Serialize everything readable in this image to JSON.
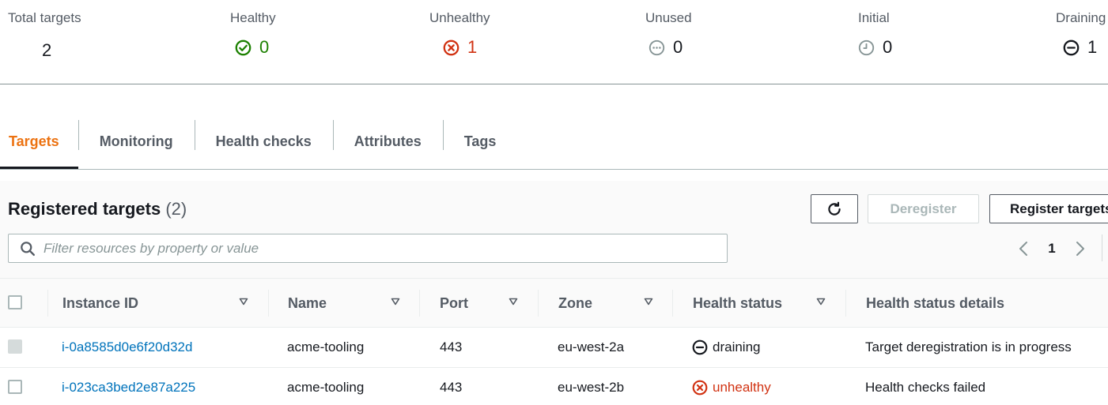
{
  "summary": {
    "total_targets": {
      "label": "Total targets",
      "value": "2"
    },
    "healthy": {
      "label": "Healthy",
      "value": "0",
      "icon": "check-circle-icon",
      "color": "#1d8102"
    },
    "unhealthy": {
      "label": "Unhealthy",
      "value": "1",
      "icon": "x-circle-icon",
      "color": "#d13212"
    },
    "unused": {
      "label": "Unused",
      "value": "0",
      "icon": "ellipsis-circle-icon",
      "color": "#879596"
    },
    "initial": {
      "label": "Initial",
      "value": "0",
      "icon": "clock-icon",
      "color": "#879596"
    },
    "draining": {
      "label": "Draining",
      "value": "1",
      "icon": "minus-circle-icon",
      "color": "#16191f"
    }
  },
  "tabs": [
    {
      "label": "Targets",
      "active": true
    },
    {
      "label": "Monitoring",
      "active": false
    },
    {
      "label": "Health checks",
      "active": false
    },
    {
      "label": "Attributes",
      "active": false
    },
    {
      "label": "Tags",
      "active": false
    }
  ],
  "registered_targets": {
    "title": "Registered targets",
    "count": "(2)",
    "refresh_icon": "refresh-icon",
    "deregister_label": "Deregister",
    "register_label": "Register targets",
    "filter_placeholder": "Filter resources by property or value",
    "current_page": "1"
  },
  "table": {
    "columns": [
      "Instance ID",
      "Name",
      "Port",
      "Zone",
      "Health status",
      "Health status details"
    ],
    "rows": [
      {
        "instance_id": "i-0a8585d0e6f20d32d",
        "name": "acme-tooling",
        "port": "443",
        "zone": "eu-west-2a",
        "health_status": "draining",
        "health_icon": "minus-circle-icon",
        "details": "Target deregistration is in progress",
        "selectable": false
      },
      {
        "instance_id": "i-023ca3bed2e87a225",
        "name": "acme-tooling",
        "port": "443",
        "zone": "eu-west-2b",
        "health_status": "unhealthy",
        "health_icon": "x-circle-icon",
        "details": "Health checks failed",
        "selectable": true
      }
    ]
  },
  "colors": {
    "accent_orange": "#ec7211",
    "link_blue": "#0073bb",
    "healthy_green": "#1d8102",
    "error_red": "#d13212"
  }
}
